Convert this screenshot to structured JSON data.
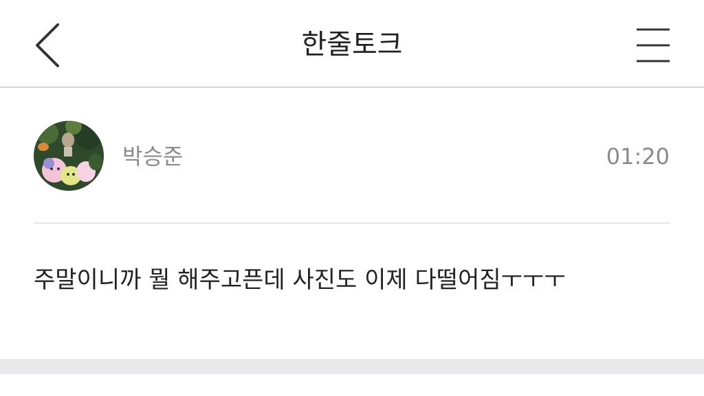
{
  "header": {
    "title": "한줄토크",
    "back_icon": "chevron-left-icon",
    "menu_icon": "hamburger-menu-icon"
  },
  "post": {
    "author": "박승준",
    "time": "01:20",
    "message": "주말이니까 뭘 해주고픈데 사진도 이제 다떨어짐ㅜㅜㅜ"
  },
  "colors": {
    "text": "#222222",
    "muted": "#8a8a8a",
    "divider": "#e6e6e6",
    "footer": "#e9e9eb"
  }
}
